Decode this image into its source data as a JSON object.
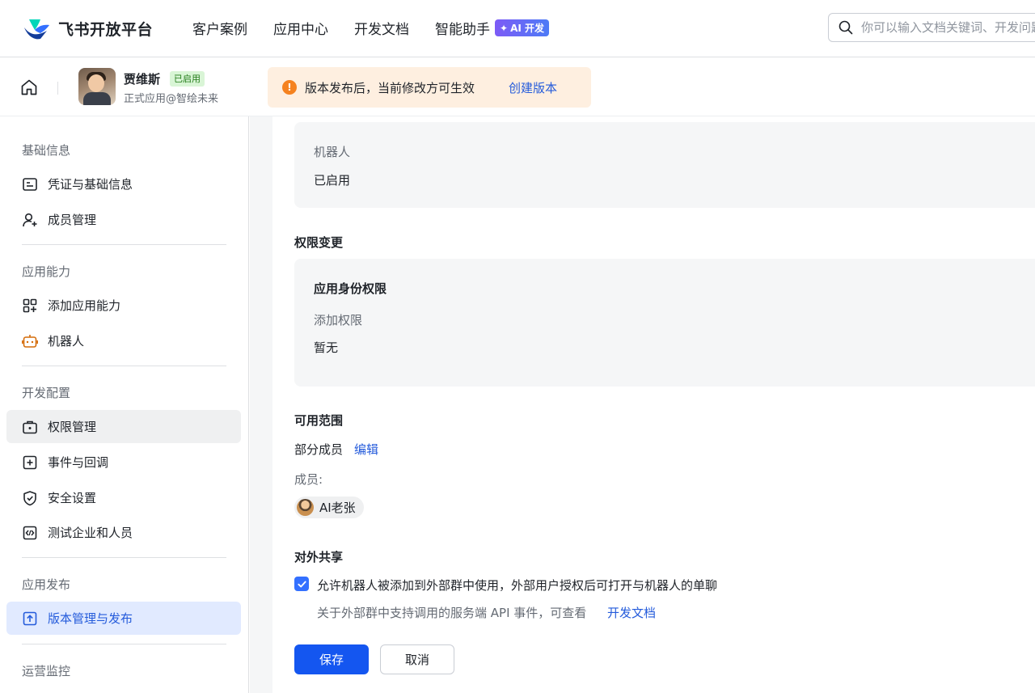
{
  "topbar": {
    "logo_text": "飞书开放平台",
    "nav": [
      "客户案例",
      "应用中心",
      "开发文档",
      "智能助手"
    ],
    "ai_badge": "AI 开发",
    "search_placeholder": "你可以输入文档关键词、开发问题"
  },
  "app": {
    "name": "贾维斯",
    "status": "已启用",
    "subtitle": "正式应用@智绘未来"
  },
  "notice": {
    "icon": "!",
    "message": "版本发布后，当前修改方可生效",
    "action": "创建版本"
  },
  "sidebar": {
    "groups": [
      {
        "title": "基础信息",
        "items": [
          {
            "label": "凭证与基础信息",
            "icon": "id-card-icon"
          },
          {
            "label": "成员管理",
            "icon": "add-user-icon"
          }
        ]
      },
      {
        "title": "应用能力",
        "items": [
          {
            "label": "添加应用能力",
            "icon": "apps-add-icon"
          },
          {
            "label": "机器人",
            "icon": "robot-icon"
          }
        ]
      },
      {
        "title": "开发配置",
        "items": [
          {
            "label": "权限管理",
            "icon": "briefcase-icon"
          },
          {
            "label": "事件与回调",
            "icon": "event-add-icon"
          },
          {
            "label": "安全设置",
            "icon": "shield-icon"
          },
          {
            "label": "测试企业和人员",
            "icon": "code-icon"
          }
        ]
      },
      {
        "title": "应用发布",
        "items": [
          {
            "label": "版本管理与发布",
            "icon": "upload-icon"
          }
        ]
      },
      {
        "title": "运营监控",
        "items": []
      }
    ]
  },
  "main": {
    "robot": {
      "label": "机器人",
      "value": "已启用"
    },
    "permissions": {
      "title": "权限变更",
      "card_title": "应用身份权限",
      "add_label": "添加权限",
      "add_value": "暂无"
    },
    "scope": {
      "title": "可用范围",
      "value": "部分成员",
      "edit": "编辑",
      "members_label": "成员:",
      "members": [
        "AI老张"
      ]
    },
    "sharing": {
      "title": "对外共享",
      "checked": true,
      "checkbox_label": "允许机器人被添加到外部群中使用，外部用户授权后可打开与机器人的单聊",
      "hint": "关于外部群中支持调用的服务端 API 事件，可查看",
      "hint_link": "开发文档"
    },
    "buttons": {
      "save": "保存",
      "cancel": "取消"
    }
  },
  "colors": {
    "accent": "#245bdb",
    "primary_button": "#1456f0",
    "checkbox": "#3370ff",
    "notice_bg": "#feefe0",
    "warn_icon": "#f5821f",
    "active_nav_bg": "#e1eaff",
    "status_badge_bg": "#d9f5d6"
  }
}
